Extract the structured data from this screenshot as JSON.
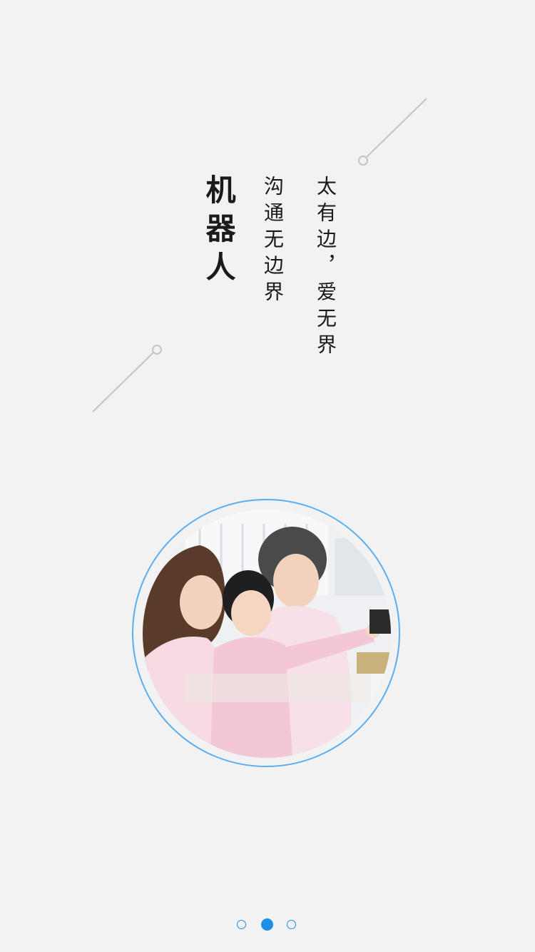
{
  "slogan": {
    "title": "机器人",
    "line_middle": "沟通无边界",
    "line_right": "太有边，爱无界"
  },
  "photo": {
    "icon": "family-selfie-photo"
  },
  "pager": {
    "total_pages": 3,
    "current_page": 2
  },
  "colors": {
    "background": "#f2f2f2",
    "accent": "#1d8fe6",
    "ring": "#5aaef0",
    "text": "#1a1a1a",
    "decor_line": "#c4c4c4"
  }
}
